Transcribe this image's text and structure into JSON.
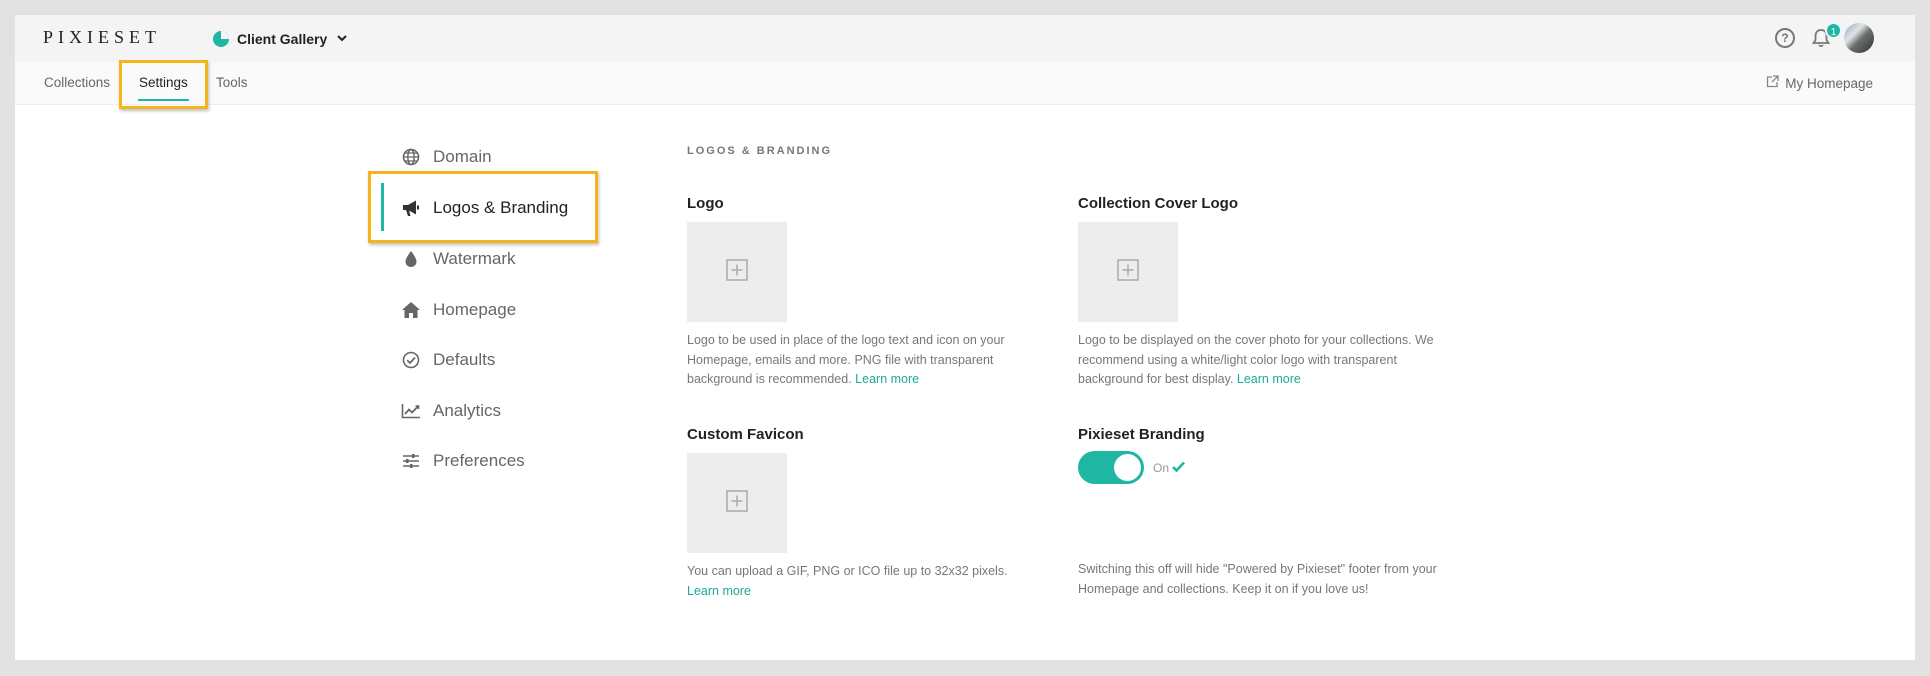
{
  "header": {
    "brand": "PIXIESET",
    "app_name": "Client Gallery",
    "notification_count": "1",
    "help_glyph": "?"
  },
  "nav": {
    "tabs": [
      {
        "label": "Collections"
      },
      {
        "label": "Settings"
      },
      {
        "label": "Tools"
      }
    ],
    "active_tab": "Settings",
    "my_homepage": "My Homepage"
  },
  "sidebar": {
    "items": [
      {
        "label": "Domain",
        "icon": "globe-icon"
      },
      {
        "label": "Logos & Branding",
        "icon": "megaphone-icon"
      },
      {
        "label": "Watermark",
        "icon": "droplet-icon"
      },
      {
        "label": "Homepage",
        "icon": "home-icon"
      },
      {
        "label": "Defaults",
        "icon": "check-circle-icon"
      },
      {
        "label": "Analytics",
        "icon": "chart-line-icon"
      },
      {
        "label": "Preferences",
        "icon": "sliders-icon"
      }
    ],
    "active": "Logos & Branding"
  },
  "main": {
    "heading": "LOGOS & BRANDING",
    "logo": {
      "label": "Logo",
      "desc": "Logo to be used in place of the logo text and icon on your Homepage, emails and more. PNG file with transparent background is recommended.",
      "link": "Learn more"
    },
    "cover_logo": {
      "label": "Collection Cover Logo",
      "desc": "Logo to be displayed on the cover photo for your collections. We recommend using a white/light color logo with transparent background for best display.",
      "link": "Learn more"
    },
    "favicon": {
      "label": "Custom Favicon",
      "desc": "You can upload a GIF, PNG or ICO file up to 32x32 pixels.",
      "link": "Learn more"
    },
    "branding": {
      "label": "Pixieset Branding",
      "toggle_state": "On",
      "enabled": true,
      "desc": "Switching this off will hide \"Powered by Pixieset\" footer from your Homepage and collections. Keep it on if you love us!"
    }
  },
  "colors": {
    "accent": "#1fb6a3",
    "highlight": "#f4b41a"
  }
}
